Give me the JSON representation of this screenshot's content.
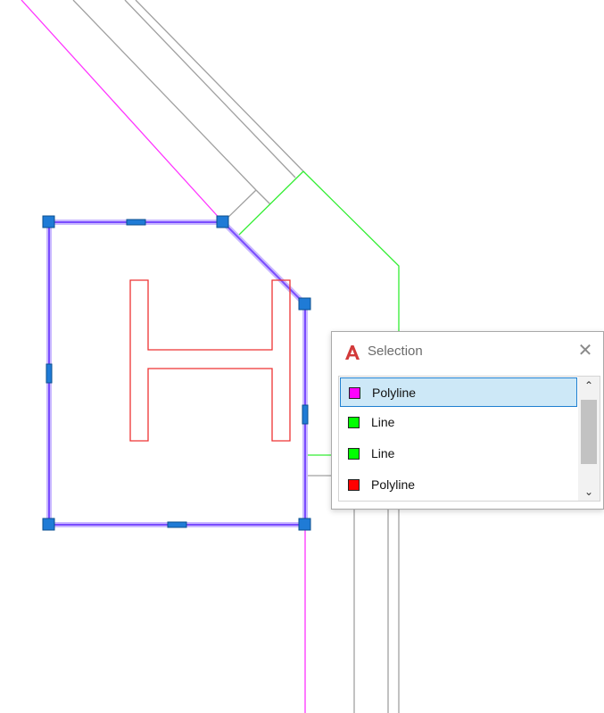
{
  "dialog": {
    "title": "Selection",
    "close_glyph": "✕",
    "app_icon": "autocad-logo-icon",
    "scroll_up_glyph": "⌃",
    "scroll_down_glyph": "⌄",
    "items": [
      {
        "label": "Polyline",
        "color": "#ff00ff",
        "selected": true
      },
      {
        "label": "Line",
        "color": "#00ff00",
        "selected": false
      },
      {
        "label": "Line",
        "color": "#00ff00",
        "selected": false
      },
      {
        "label": "Polyline",
        "color": "#ff0000",
        "selected": false
      }
    ]
  },
  "colors": {
    "selected_outline": "#7a4cff",
    "grip": "#1f7bd6",
    "magenta": "#ff33ff",
    "green": "#33ee33",
    "red": "#ee3333",
    "gray_line": "#9a9a9a",
    "selection_bg": "#cde8f7",
    "selection_border": "#1f80d0"
  }
}
